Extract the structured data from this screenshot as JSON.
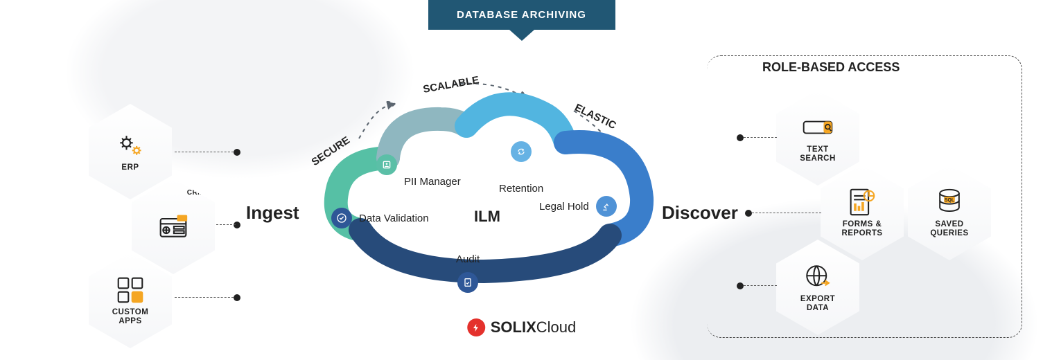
{
  "header": {
    "title": "DATABASE ARCHIVING"
  },
  "ingest": {
    "label": "Ingest",
    "sources": [
      {
        "id": "erp",
        "label": "ERP"
      },
      {
        "id": "crm",
        "label": "CRM"
      },
      {
        "id": "custom_apps",
        "label": "CUSTOM\nAPPS"
      }
    ]
  },
  "cloud": {
    "center_label": "ILM",
    "qualities": {
      "secure": "SECURE",
      "scalable": "SCALABLE",
      "elastic": "ELASTIC"
    },
    "features": {
      "data_validation": "Data Validation",
      "pii_manager": "PII Manager",
      "retention": "Retention",
      "legal_hold": "Legal Hold",
      "audit": "Audit"
    }
  },
  "discover": {
    "label": "Discover"
  },
  "access_panel": {
    "title": "ROLE-BASED ACCESS",
    "items": [
      {
        "id": "text_search",
        "label": "TEXT\nSEARCH"
      },
      {
        "id": "forms_reports",
        "label": "FORMS &\nREPORTS"
      },
      {
        "id": "export_data",
        "label": "EXPORT\nDATA"
      },
      {
        "id": "saved_queries",
        "label": "SAVED\nQUERIES"
      }
    ]
  },
  "brand": {
    "name_bold": "SOLIX",
    "name_light": "Cloud"
  },
  "colors": {
    "navy": "#215774",
    "teal": "#56c0a5",
    "blue": "#3a7ecb",
    "lightblue": "#52b5e0",
    "deep_blue": "#274b7a",
    "amber": "#f5a623",
    "red": "#e4312c"
  }
}
